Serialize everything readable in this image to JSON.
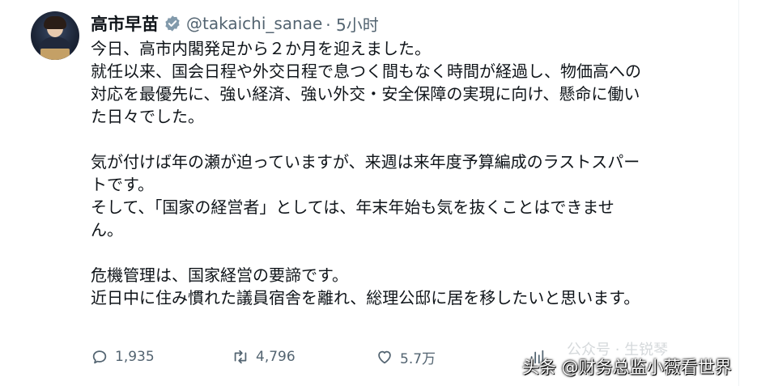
{
  "tweet": {
    "author_name": "高市早苗",
    "handle": "@takaichi_sanae",
    "time": "· 5小时",
    "lines": [
      "今日、高市内閣発足から２か月を迎えました。",
      "就任以来、国会日程や外交日程で息つく間もなく時間が経過し、物価高への",
      "対応を最優先に、強い経済、強い外交・安全保障の実現に向け、懸命に働い",
      "た日々でした。",
      "",
      "気が付けば年の瀬が迫っていますが、来週は来年度予算編成のラストスパー",
      "トです。",
      "そして、「国家の経営者」としては、年末年始も気を抜くことはできませ",
      "ん。",
      "",
      "危機管理は、国家経営の要諦です。",
      "近日中に住み慣れた議員宿舎を離れ、総理公邸に居を移したいと思います。"
    ]
  },
  "actions": {
    "reply_count": "1,935",
    "retweet_count": "4,796",
    "like_count": "5.7万"
  },
  "overlay": {
    "watermark": "头条 @财务总监小薇看世界",
    "watermark_faint": "公众号 · 生锐琴"
  },
  "colors": {
    "text": "#0f1419",
    "muted": "#536471",
    "verified": "#829aab"
  }
}
